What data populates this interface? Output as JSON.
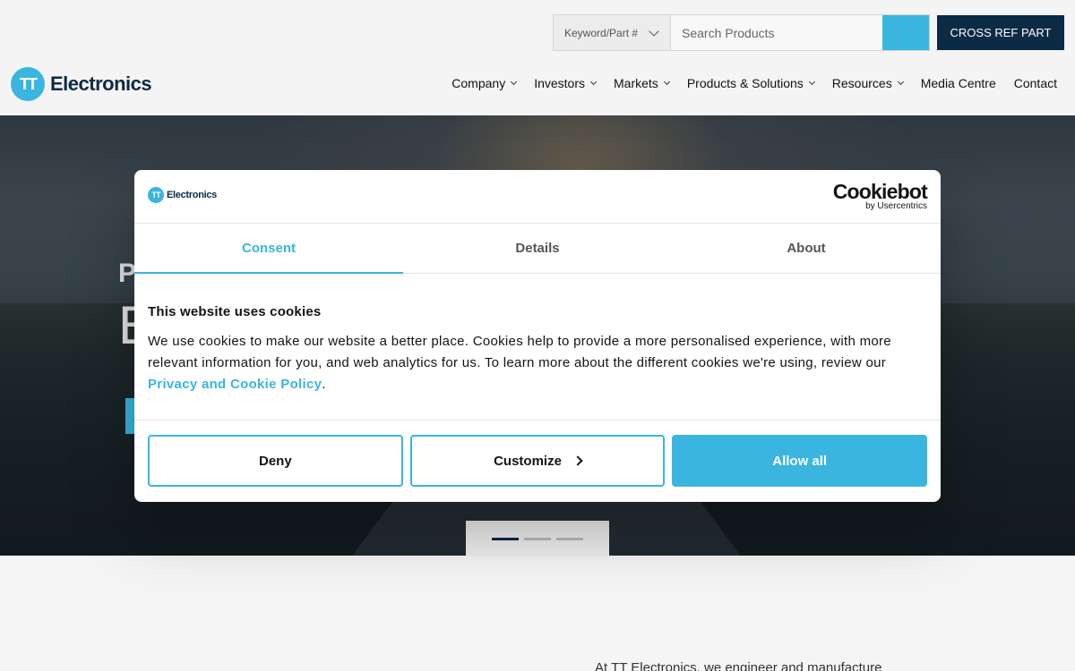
{
  "header": {
    "search_type": "Keyword/Part #",
    "search_placeholder": "Search Products",
    "cross_ref_label": "CROSS REF PART",
    "logo_mark": "TT",
    "logo_text": "Electronics"
  },
  "nav": {
    "items": [
      {
        "label": "Company",
        "has_dropdown": true
      },
      {
        "label": "Investors",
        "has_dropdown": true
      },
      {
        "label": "Markets",
        "has_dropdown": true
      },
      {
        "label": "Products & Solutions",
        "has_dropdown": true
      },
      {
        "label": "Resources",
        "has_dropdown": true
      },
      {
        "label": "Media Centre",
        "has_dropdown": false
      },
      {
        "label": "Contact",
        "has_dropdown": false
      }
    ]
  },
  "hero": {
    "line1_partial": "P",
    "line2_partial": "E",
    "slide_count": 3,
    "active_slide": 1
  },
  "intro_text": "At TT Electronics, we engineer and manufacture",
  "cookie_dialog": {
    "logo_mark": "TT",
    "logo_text": "Electronics",
    "brand_title": "Cookiebot",
    "brand_sub": "by Usercentrics",
    "tabs": [
      "Consent",
      "Details",
      "About"
    ],
    "active_tab": "Consent",
    "heading": "This website uses cookies",
    "body_text": "We use cookies to make our website a better place. Cookies help to provide a more personalised experience, with more relevant information for you, and web analytics for us. To learn more about the different cookies we're using, review our ",
    "link_text": "Privacy and Cookie Policy",
    "body_end": ".",
    "buttons": {
      "deny": "Deny",
      "customize": "Customize",
      "allow_all": "Allow all"
    }
  },
  "colors": {
    "accent": "#3ab5e0",
    "navy": "#0b2a45"
  }
}
